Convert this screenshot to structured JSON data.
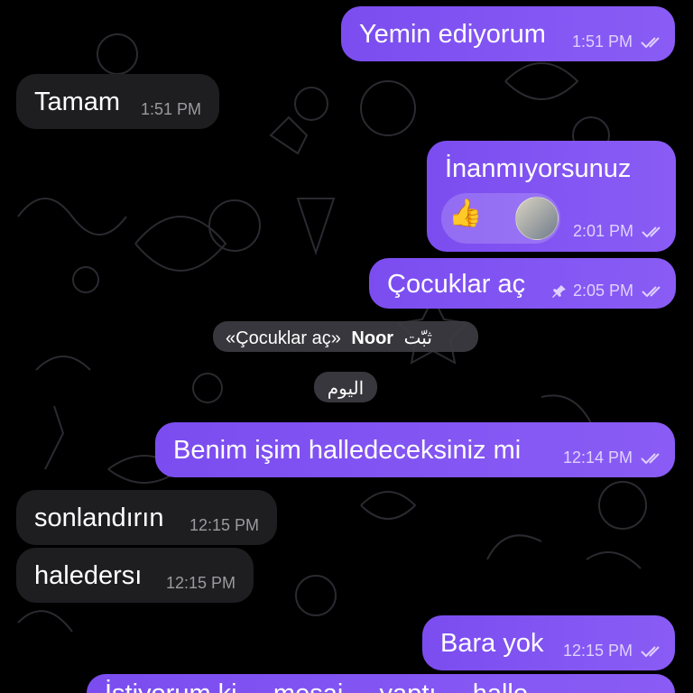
{
  "messages": [
    {
      "text": "Yemin ediyorum",
      "time": "1:51 PM"
    },
    {
      "text": "Tamam",
      "time": "1:51 PM"
    },
    {
      "text": "İnanmıyorsunuz",
      "time": "2:01 PM",
      "reaction": "👍"
    },
    {
      "text": "Çocuklar aç",
      "time": "2:05 PM",
      "pinned": true
    },
    {
      "text": "Benim işim halledeceksiniz mi",
      "time": "12:14 PM"
    },
    {
      "text": "sonlandırın",
      "time": "12:15 PM"
    },
    {
      "text": "haledersı",
      "time": "12:15 PM"
    },
    {
      "text": "Bara yok",
      "time": "12:15 PM"
    },
    {
      "text": "İstiyorum ki ... mesaj ... yaptı ... hallo",
      "time": ""
    }
  ],
  "service": {
    "pin_text": "ثبّت Noor «Çocuklar aç»",
    "pin_prefix": "ثبّت",
    "pin_name": "Noor",
    "pin_quote": "«Çocuklar aç»",
    "date_label": "اليوم"
  },
  "colors": {
    "outgoing_bubble": "#8a5cf5",
    "incoming_bubble": "#1e1e21",
    "background": "#000000"
  },
  "icons": [
    "double-check-icon",
    "pin-icon",
    "thumbs-up-icon",
    "avatar"
  ]
}
